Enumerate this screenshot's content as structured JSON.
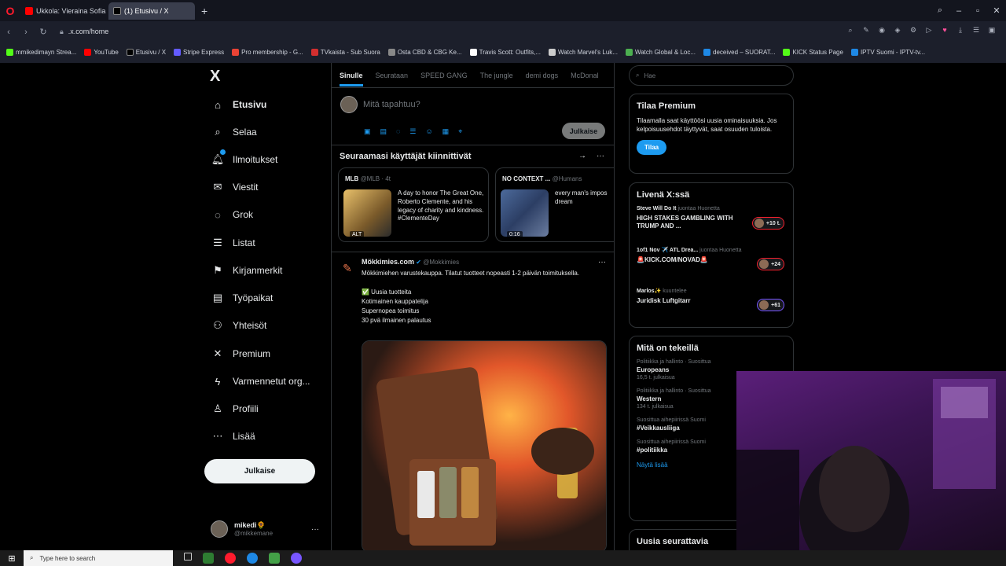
{
  "browser": {
    "tabs": [
      {
        "label": "Ukkola: Vieraina Sofia Virt",
        "favicon_color": "#ff0000",
        "active": false
      },
      {
        "label": "(1) Etusivu / X",
        "favicon_color": "#000000",
        "active": true
      }
    ],
    "new_tab": "+",
    "url": ".x.com/home",
    "bookmarks": [
      {
        "label": "mmikedimayn Strea...",
        "color": "#53fc18"
      },
      {
        "label": "YouTube",
        "color": "#ff0000"
      },
      {
        "label": "Etusivu / X",
        "color": "#000000"
      },
      {
        "label": "Stripe Express",
        "color": "#635bff"
      },
      {
        "label": "Pro membership - G...",
        "color": "#ea4335"
      },
      {
        "label": "TVkaista - Sub Suora",
        "color": "#d32f2f"
      },
      {
        "label": "Osta CBD & CBG Ke...",
        "color": "#888888"
      },
      {
        "label": "Travis Scott: Outfits,...",
        "color": "#ffffff"
      },
      {
        "label": "Watch Marvel's Luk...",
        "color": "#cccccc"
      },
      {
        "label": "Watch Global & Loc...",
        "color": "#4caf50"
      },
      {
        "label": "deceived – SUORAT...",
        "color": "#1e88e5"
      },
      {
        "label": "KICK Status Page",
        "color": "#53fc18"
      },
      {
        "label": "IPTV Suomi - IPTV-tv...",
        "color": "#1e88e5"
      }
    ]
  },
  "nav": {
    "logo": "X",
    "items": [
      {
        "label": "Etusivu",
        "icon": "home-icon",
        "glyph": "⌂",
        "bold": true
      },
      {
        "label": "Selaa",
        "icon": "search-icon",
        "glyph": "⌕"
      },
      {
        "label": "Ilmoitukset",
        "icon": "bell-icon",
        "glyph": "🔔︎",
        "badge": true
      },
      {
        "label": "Viestit",
        "icon": "mail-icon",
        "glyph": "✉"
      },
      {
        "label": "Grok",
        "icon": "grok-icon",
        "glyph": "◌"
      },
      {
        "label": "Listat",
        "icon": "list-icon",
        "glyph": "☰"
      },
      {
        "label": "Kirjanmerkit",
        "icon": "bookmark-icon",
        "glyph": "⚑"
      },
      {
        "label": "Työpaikat",
        "icon": "briefcase-icon",
        "glyph": "▤"
      },
      {
        "label": "Yhteisöt",
        "icon": "communities-icon",
        "glyph": "⚇"
      },
      {
        "label": "Premium",
        "icon": "x-premium-icon",
        "glyph": "✕"
      },
      {
        "label": "Varmennetut org...",
        "icon": "lightning-icon",
        "glyph": "ϟ"
      },
      {
        "label": "Profiili",
        "icon": "profile-icon",
        "glyph": "♙"
      },
      {
        "label": "Lisää",
        "icon": "more-circle-icon",
        "glyph": "⋯"
      }
    ],
    "post_button": "Julkaise",
    "user": {
      "name": "mikedi🌻",
      "handle": "@mikkemane"
    }
  },
  "feed": {
    "tabs": [
      "Sinulle",
      "Seurataan",
      "SPEED GANG",
      "The jungle",
      "demi dogs",
      "McDonal"
    ],
    "composer_placeholder": "Mitä tapahtuu?",
    "composer_post": "Julkaise",
    "pinned_title": "Seuraamasi käyttäjät kiinnittivät",
    "cards": [
      {
        "name": "MLB",
        "meta": "@MLB · 4t",
        "text": "A day to honor The Great One, Roberto Clemente, and his legacy of charity and kindness. #ClementeDay",
        "tag": "ALT"
      },
      {
        "name": "NO CONTEXT ...",
        "meta": "@Humans",
        "text": "every man's impos dream",
        "tag": "0:16"
      }
    ],
    "tweet": {
      "name": "Mökkimies.com",
      "handle": "@Mokkimies",
      "body": "Mökkimiehen varustekauppa. Tilatut tuotteet nopeasti 1-2 päivän toimituksella.\n\n✅ Uusia tuotteita\nKotimainen kauppatelija\nSupernopea toimitus\n30 pvä ilmainen palautus"
    }
  },
  "right": {
    "search_placeholder": "Hae",
    "premium": {
      "title": "Tilaa Premium",
      "text": "Tilaamalla saat käyttöösi uusia ominaisuuksia. Jos kelpoisuusehdot täyttyvät, saat osuuden tuloista.",
      "button": "Tilaa"
    },
    "live": {
      "title": "Livenä X:ssä",
      "items": [
        {
          "host": "Steve Will Do It",
          "role": "juontaa Huonetta",
          "title": "HIGH STAKES GAMBLING WITH TRUMP AND ...",
          "count": "+10 t."
        },
        {
          "host": "1of1 Nov ✈️ ATL Drea...",
          "role": "juontaa Huonetta",
          "title": "🚨KICK.COM/NOVAD🚨",
          "count": "+24"
        },
        {
          "host": "Marlos✨",
          "role": "kuuntelee",
          "title": "Juridisk Luftgitarr",
          "count": "+61"
        }
      ]
    },
    "trending": {
      "title": "Mitä on tekeillä",
      "items": [
        {
          "meta": "Politiikka ja hallinto · Suosittua",
          "name": "Europeans",
          "count": "16,5 t. julkaisua"
        },
        {
          "meta": "Politiikka ja hallinto · Suosittua",
          "name": "Western",
          "count": "134 t. julkaisua"
        },
        {
          "meta": "Suosittua aihepiirissä Suomi",
          "name": "#Veikkausliiga",
          "count": ""
        },
        {
          "meta": "Suosittua aihepiirissä Suomi",
          "name": "#politiikka",
          "count": ""
        }
      ],
      "show_more": "Näytä lisää"
    },
    "follow_title": "Uusia seurattavia"
  },
  "taskbar": {
    "search_placeholder": "Type here to search"
  }
}
